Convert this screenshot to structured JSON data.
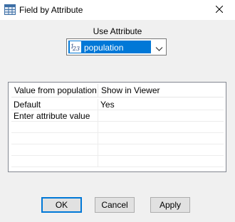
{
  "window": {
    "title": "Field by Attribute",
    "icons": {
      "app": "field-grid-icon",
      "close": "close-icon"
    }
  },
  "use_attribute": {
    "label": "Use Attribute",
    "selected": "population",
    "type_icon": "numeric-123-icon",
    "selection_color": "#0078d7"
  },
  "table": {
    "columns": [
      "Value from population",
      "Show in Viewer"
    ],
    "rows": [
      {
        "value": "Default",
        "show": "Yes"
      },
      {
        "value": "Enter attribute value",
        "show": ""
      },
      {
        "value": "",
        "show": ""
      },
      {
        "value": "",
        "show": ""
      },
      {
        "value": "",
        "show": ""
      },
      {
        "value": "",
        "show": ""
      }
    ]
  },
  "buttons": {
    "ok": "OK",
    "cancel": "Cancel",
    "apply": "Apply"
  }
}
